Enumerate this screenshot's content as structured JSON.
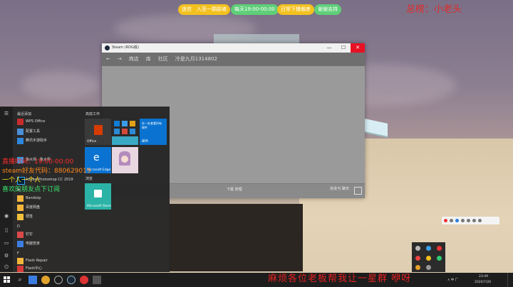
{
  "stream": {
    "pills": [
      {
        "label": "迷信　入圣一颗路坡",
        "color": "#f3c11f"
      },
      {
        "label": "每天19:00-00:00",
        "color": "#5fcf79"
      },
      {
        "label": "日常下播偏差",
        "color": "#f3c11f"
      },
      {
        "label": "谢谢支持",
        "color": "#5fcf79"
      }
    ],
    "total_rank": "总榜：小老头",
    "overlay_lines": [
      {
        "text": "直播时间：19:00-00:00",
        "color": "#ff2c2c"
      },
      {
        "text": "steam好友代码：880629019",
        "color": "#ff8a1c"
      },
      {
        "text": "一个人一个人",
        "color": "#ffe21c"
      },
      {
        "text": "喜欢的朋友点下订阅",
        "color": "#3be66b"
      }
    ],
    "banner": "麻烦各位老板帮我让一星群 咿呀"
  },
  "steam_window": {
    "title": "Steam (ROG版)",
    "nav": [
      "←",
      "→",
      "商店",
      "库",
      "社区",
      "冷是九月1314802"
    ],
    "bottom_center": "下载\n管理",
    "bottom_right": "好友与\n聊天",
    "controls": [
      "—",
      "☐",
      "✕"
    ]
  },
  "start_menu": {
    "section_recent": "最近添加",
    "recent_apps": [
      {
        "label": "WPS Office",
        "color": "#c72c2c"
      },
      {
        "label": "配置工具",
        "color": "#4a8fd9"
      },
      {
        "label": "腾讯手游助手",
        "color": "#2e86de"
      },
      {
        "label": "鲁大师 · 鲁大师",
        "color": "#3a9be0"
      }
    ],
    "ps_label": "Adobe Photoshop CC 2019",
    "section_hash": "#",
    "hash_apps": [
      {
        "label": "Bandizip",
        "color": "#f3b63c"
      },
      {
        "label": "百度网盘",
        "color": "#f3b63c"
      },
      {
        "label": "便签",
        "color": "#f3c23c"
      }
    ],
    "section_d": "D",
    "d_apps": [
      {
        "label": "钉钉",
        "color": "#d84a4a"
      },
      {
        "label": "电脑管家",
        "color": "#3b7ee0"
      }
    ],
    "section_f": "F",
    "f_apps": [
      {
        "label": "Flash Repair",
        "color": "#f3b63c"
      },
      {
        "label": "Flash中心",
        "color": "#d83a3a"
      }
    ],
    "tiles_section_1": "高效工作",
    "tile_office": "Office",
    "tile_email_top": "在一处查看所有\n邮件",
    "tile_email": "邮件",
    "tile_edge": "Microsoft Edge",
    "tiles_section_2": "浏览",
    "tile_store": "Microsoft Store"
  },
  "taskbar": {
    "clock_time": "23:49",
    "clock_date": "2020/7/26",
    "tray_text": "∧ 中 ㄏ"
  }
}
